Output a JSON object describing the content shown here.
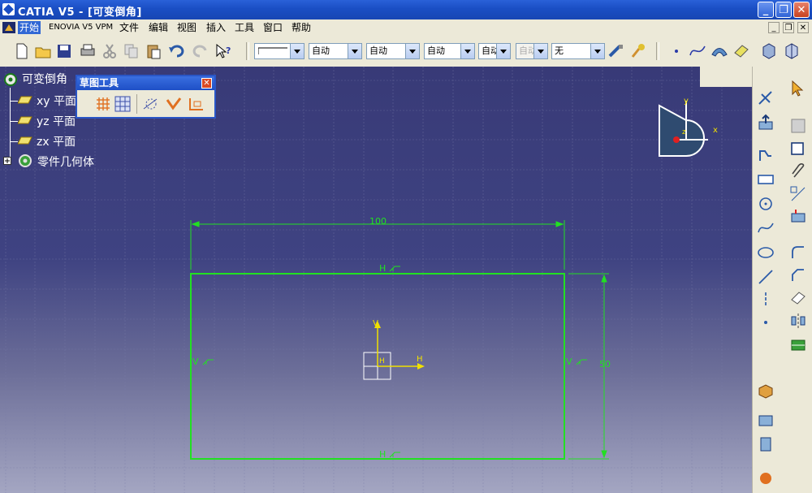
{
  "window": {
    "title": "CATIA V5 - [可变倒角]",
    "minimize": "_",
    "restore": "❐",
    "close": "✕"
  },
  "menu": {
    "items": [
      "开始",
      "ENOVIA V5 VPM",
      "文件",
      "编辑",
      "视图",
      "插入",
      "工具",
      "窗口",
      "帮助"
    ],
    "mdi_minimize": "_",
    "mdi_restore": "❐",
    "mdi_close": "✕"
  },
  "toolbar": {
    "dropdowns": [
      {
        "value": ""
      },
      {
        "value": "自动"
      },
      {
        "value": "自动"
      },
      {
        "value": "自动"
      },
      {
        "value": "自动"
      },
      {
        "value": "自动",
        "disabled": true
      },
      {
        "value": "无"
      }
    ]
  },
  "tree": {
    "root": "可变倒角",
    "items": [
      "xy 平面",
      "yz 平面",
      "zx 平面"
    ],
    "body": "零件几何体"
  },
  "toolbox": {
    "title": "草图工具",
    "close": "✕"
  },
  "compass": {
    "x": "x",
    "y": "y",
    "z": "z"
  },
  "sketch": {
    "dim_width": "100",
    "dim_height": "50",
    "constraint_h": "H",
    "constraint_v": "V",
    "axis_h": "H",
    "axis_v": "V"
  },
  "colors": {
    "sketch_green": "#22e022",
    "axis_yellow": "#f0e000",
    "titlebar_blue": "#1a4ec4",
    "canvas_top": "#383a77"
  }
}
